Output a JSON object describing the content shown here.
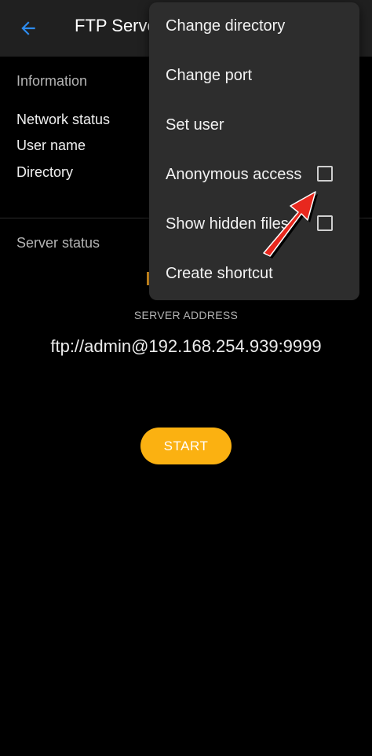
{
  "app_bar": {
    "title": "FTP Server",
    "back_icon": "arrow-back-icon"
  },
  "information": {
    "heading": "Information",
    "rows": [
      {
        "label": "Network status"
      },
      {
        "label": "User name"
      },
      {
        "label": "Directory"
      }
    ]
  },
  "server_status": {
    "heading": "Server status",
    "address_label": "SERVER ADDRESS",
    "address_value": "ftp://admin@192.168.254.939:9999",
    "start_label": "START"
  },
  "menu": {
    "items": [
      {
        "label": "Change directory"
      },
      {
        "label": "Change port"
      },
      {
        "label": "Set user"
      },
      {
        "label": "Anonymous access",
        "checkbox": false
      },
      {
        "label": "Show hidden files",
        "checkbox": false
      },
      {
        "label": "Create shortcut"
      }
    ]
  },
  "colors": {
    "accent_blue": "#2d8cf0",
    "start_button": "#fbb111",
    "annotation_arrow": "#e8281e"
  }
}
